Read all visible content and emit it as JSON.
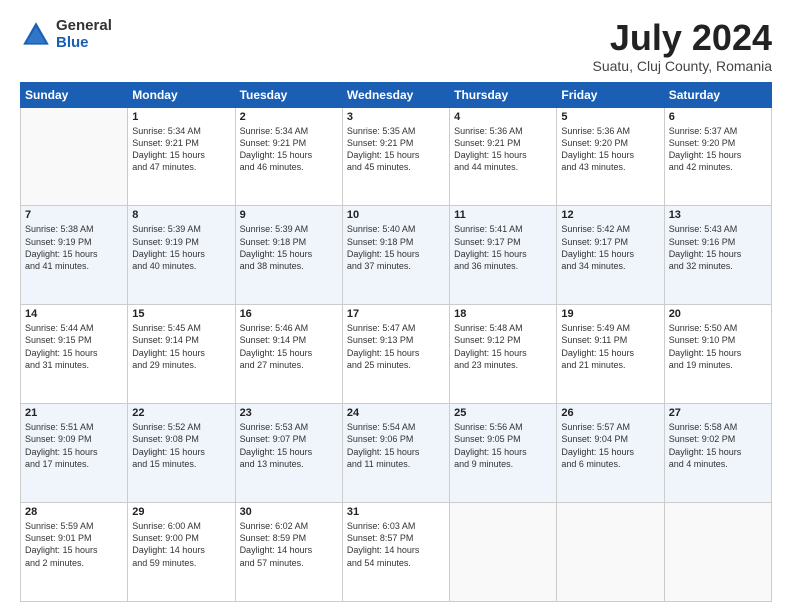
{
  "logo": {
    "general": "General",
    "blue": "Blue"
  },
  "header": {
    "month": "July 2024",
    "location": "Suatu, Cluj County, Romania"
  },
  "days_of_week": [
    "Sunday",
    "Monday",
    "Tuesday",
    "Wednesday",
    "Thursday",
    "Friday",
    "Saturday"
  ],
  "weeks": [
    [
      {
        "day": "",
        "info": ""
      },
      {
        "day": "1",
        "info": "Sunrise: 5:34 AM\nSunset: 9:21 PM\nDaylight: 15 hours\nand 47 minutes."
      },
      {
        "day": "2",
        "info": "Sunrise: 5:34 AM\nSunset: 9:21 PM\nDaylight: 15 hours\nand 46 minutes."
      },
      {
        "day": "3",
        "info": "Sunrise: 5:35 AM\nSunset: 9:21 PM\nDaylight: 15 hours\nand 45 minutes."
      },
      {
        "day": "4",
        "info": "Sunrise: 5:36 AM\nSunset: 9:21 PM\nDaylight: 15 hours\nand 44 minutes."
      },
      {
        "day": "5",
        "info": "Sunrise: 5:36 AM\nSunset: 9:20 PM\nDaylight: 15 hours\nand 43 minutes."
      },
      {
        "day": "6",
        "info": "Sunrise: 5:37 AM\nSunset: 9:20 PM\nDaylight: 15 hours\nand 42 minutes."
      }
    ],
    [
      {
        "day": "7",
        "info": "Sunrise: 5:38 AM\nSunset: 9:19 PM\nDaylight: 15 hours\nand 41 minutes."
      },
      {
        "day": "8",
        "info": "Sunrise: 5:39 AM\nSunset: 9:19 PM\nDaylight: 15 hours\nand 40 minutes."
      },
      {
        "day": "9",
        "info": "Sunrise: 5:39 AM\nSunset: 9:18 PM\nDaylight: 15 hours\nand 38 minutes."
      },
      {
        "day": "10",
        "info": "Sunrise: 5:40 AM\nSunset: 9:18 PM\nDaylight: 15 hours\nand 37 minutes."
      },
      {
        "day": "11",
        "info": "Sunrise: 5:41 AM\nSunset: 9:17 PM\nDaylight: 15 hours\nand 36 minutes."
      },
      {
        "day": "12",
        "info": "Sunrise: 5:42 AM\nSunset: 9:17 PM\nDaylight: 15 hours\nand 34 minutes."
      },
      {
        "day": "13",
        "info": "Sunrise: 5:43 AM\nSunset: 9:16 PM\nDaylight: 15 hours\nand 32 minutes."
      }
    ],
    [
      {
        "day": "14",
        "info": "Sunrise: 5:44 AM\nSunset: 9:15 PM\nDaylight: 15 hours\nand 31 minutes."
      },
      {
        "day": "15",
        "info": "Sunrise: 5:45 AM\nSunset: 9:14 PM\nDaylight: 15 hours\nand 29 minutes."
      },
      {
        "day": "16",
        "info": "Sunrise: 5:46 AM\nSunset: 9:14 PM\nDaylight: 15 hours\nand 27 minutes."
      },
      {
        "day": "17",
        "info": "Sunrise: 5:47 AM\nSunset: 9:13 PM\nDaylight: 15 hours\nand 25 minutes."
      },
      {
        "day": "18",
        "info": "Sunrise: 5:48 AM\nSunset: 9:12 PM\nDaylight: 15 hours\nand 23 minutes."
      },
      {
        "day": "19",
        "info": "Sunrise: 5:49 AM\nSunset: 9:11 PM\nDaylight: 15 hours\nand 21 minutes."
      },
      {
        "day": "20",
        "info": "Sunrise: 5:50 AM\nSunset: 9:10 PM\nDaylight: 15 hours\nand 19 minutes."
      }
    ],
    [
      {
        "day": "21",
        "info": "Sunrise: 5:51 AM\nSunset: 9:09 PM\nDaylight: 15 hours\nand 17 minutes."
      },
      {
        "day": "22",
        "info": "Sunrise: 5:52 AM\nSunset: 9:08 PM\nDaylight: 15 hours\nand 15 minutes."
      },
      {
        "day": "23",
        "info": "Sunrise: 5:53 AM\nSunset: 9:07 PM\nDaylight: 15 hours\nand 13 minutes."
      },
      {
        "day": "24",
        "info": "Sunrise: 5:54 AM\nSunset: 9:06 PM\nDaylight: 15 hours\nand 11 minutes."
      },
      {
        "day": "25",
        "info": "Sunrise: 5:56 AM\nSunset: 9:05 PM\nDaylight: 15 hours\nand 9 minutes."
      },
      {
        "day": "26",
        "info": "Sunrise: 5:57 AM\nSunset: 9:04 PM\nDaylight: 15 hours\nand 6 minutes."
      },
      {
        "day": "27",
        "info": "Sunrise: 5:58 AM\nSunset: 9:02 PM\nDaylight: 15 hours\nand 4 minutes."
      }
    ],
    [
      {
        "day": "28",
        "info": "Sunrise: 5:59 AM\nSunset: 9:01 PM\nDaylight: 15 hours\nand 2 minutes."
      },
      {
        "day": "29",
        "info": "Sunrise: 6:00 AM\nSunset: 9:00 PM\nDaylight: 14 hours\nand 59 minutes."
      },
      {
        "day": "30",
        "info": "Sunrise: 6:02 AM\nSunset: 8:59 PM\nDaylight: 14 hours\nand 57 minutes."
      },
      {
        "day": "31",
        "info": "Sunrise: 6:03 AM\nSunset: 8:57 PM\nDaylight: 14 hours\nand 54 minutes."
      },
      {
        "day": "",
        "info": ""
      },
      {
        "day": "",
        "info": ""
      },
      {
        "day": "",
        "info": ""
      }
    ]
  ]
}
